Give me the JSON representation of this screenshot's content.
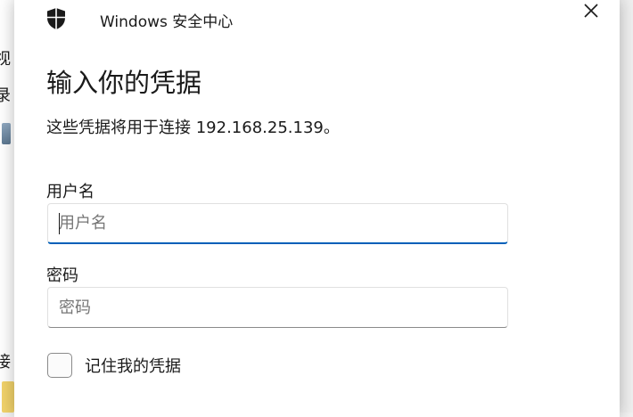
{
  "background_window": {
    "chars": [
      "视",
      "录",
      "接"
    ]
  },
  "dialog": {
    "app_title": "Windows 安全中心",
    "heading": "输入你的凭据",
    "subtext": "这些凭据将用于连接 192.168.25.139。",
    "username": {
      "label": "用户名",
      "placeholder": "用户名",
      "value": ""
    },
    "password": {
      "label": "密码",
      "placeholder": "密码",
      "value": ""
    },
    "remember": {
      "label": "记住我的凭据",
      "checked": false
    }
  },
  "icons": {
    "app": "shield-icon",
    "close": "close-icon"
  },
  "colors": {
    "accent": "#005fb8",
    "dialog_bg": "#ffffff",
    "text": "#1a1a1a",
    "placeholder": "#767676"
  }
}
